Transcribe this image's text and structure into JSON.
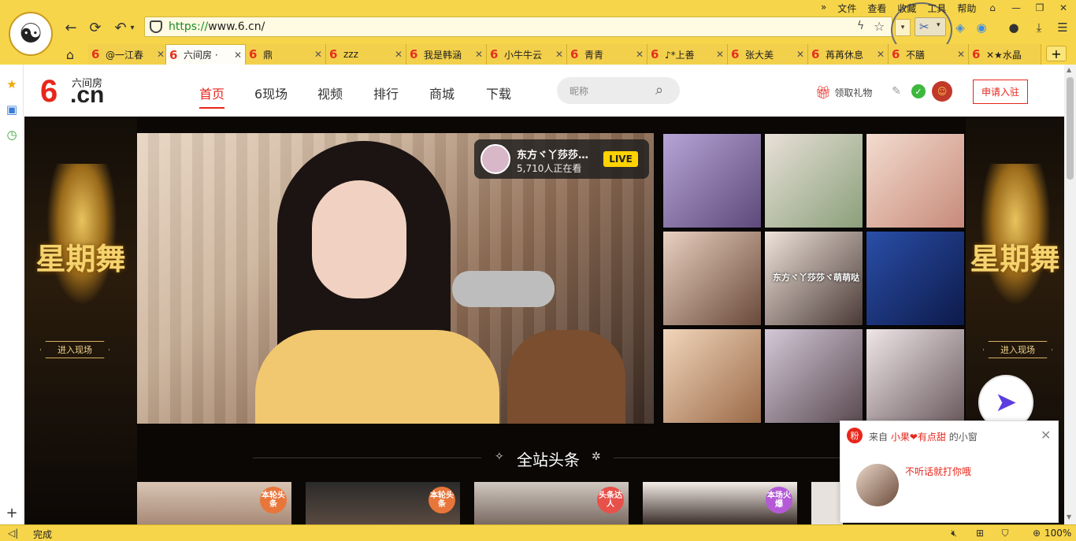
{
  "browser": {
    "url_scheme": "https://",
    "url_rest": "www.6.cn/",
    "menus": [
      "文件",
      "查看",
      "收藏",
      "工具",
      "帮助"
    ],
    "tabs": [
      {
        "label": "@一江春",
        "active": false
      },
      {
        "label": "六间房 ·",
        "active": true
      },
      {
        "label": "鼎",
        "active": false
      },
      {
        "label": "zzz",
        "active": false
      },
      {
        "label": "我是韩涵",
        "active": false
      },
      {
        "label": "小牛牛云",
        "active": false
      },
      {
        "label": "青青",
        "active": false
      },
      {
        "label": "♪*上善",
        "active": false
      },
      {
        "label": "张大美",
        "active": false
      },
      {
        "label": "苒苒休息",
        "active": false
      },
      {
        "label": "不膳",
        "active": false
      },
      {
        "label": "✕★水晶",
        "active": false
      }
    ],
    "status_text": "完成",
    "zoom": "100%"
  },
  "site": {
    "brand_sub": "六间房",
    "brand_6": "6",
    "brand_cn": ".cn",
    "nav": [
      "首页",
      "6现场",
      "视频",
      "排行",
      "商城",
      "下载"
    ],
    "search_placeholder": "昵称",
    "gift_label": "领取礼物",
    "apply_label": "申请入驻"
  },
  "hero": {
    "banner_text": "星期舞",
    "enter_label": "进入现场",
    "live": {
      "streamer": "东方ヾ丫莎莎…",
      "viewers": "5,710人正在看",
      "badge": "LIVE"
    },
    "thumb_caption": "东方ヾ丫莎莎ヾ萌萌哒",
    "headline": "全站头条",
    "cards": [
      {
        "badge": "本轮头条",
        "color": "#e8763a"
      },
      {
        "badge": "本轮头条",
        "color": "#e8763a"
      },
      {
        "badge": "头条达人",
        "color": "#e8504a"
      },
      {
        "badge": "本场火爆",
        "color": "#b45ad6"
      }
    ]
  },
  "popup": {
    "icon_label": "粉",
    "from_prefix": "来自",
    "from_name": "小果❤有点甜",
    "from_suffix": "的小窗",
    "message": "不听话就打你哦"
  },
  "colors": {
    "brand_red": "#e8261b",
    "chrome_yellow": "#f7d54a"
  }
}
